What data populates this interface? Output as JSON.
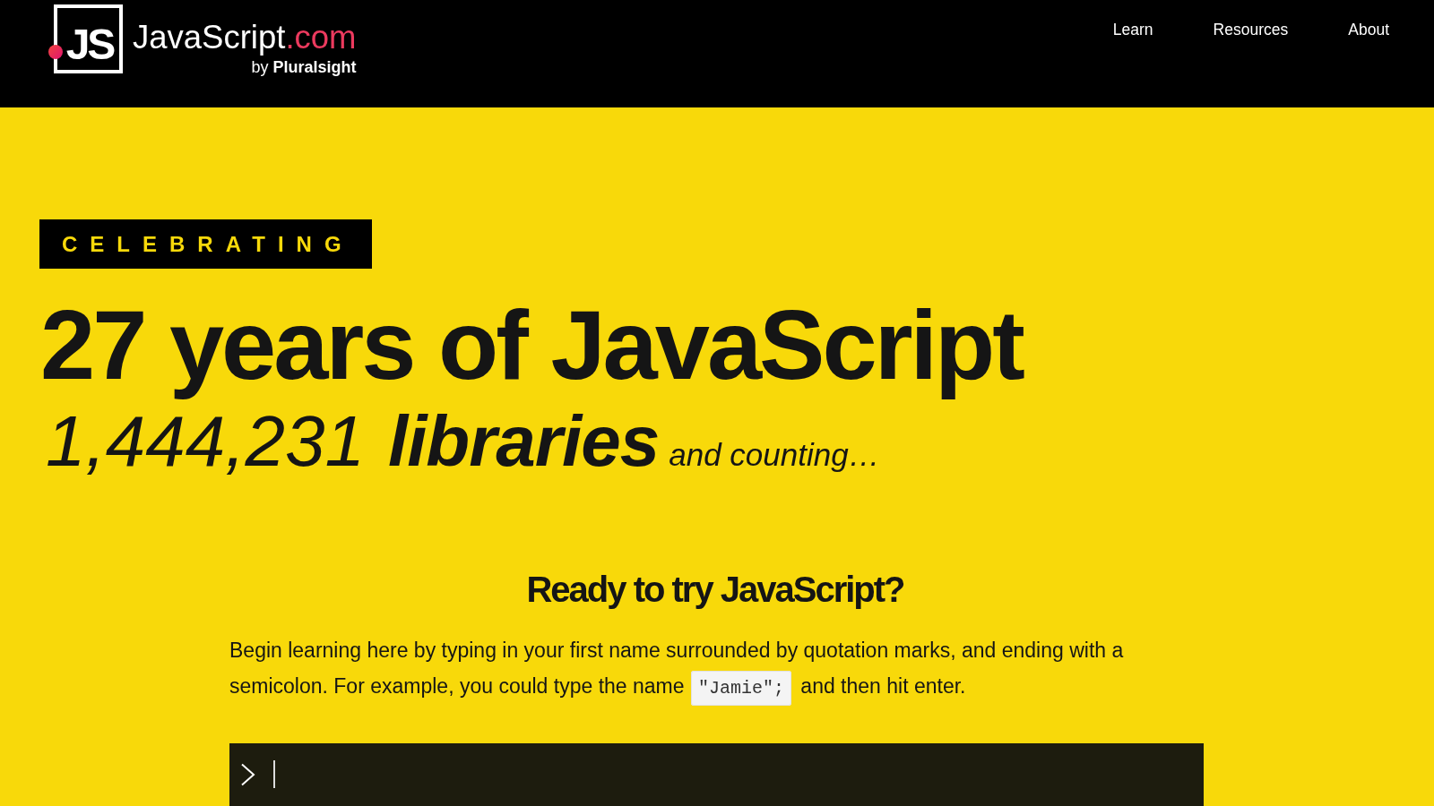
{
  "header": {
    "logo": {
      "mark": "JS",
      "wordmark": "JavaScript",
      "domain": ".com",
      "byline": "by **Pluralsight**"
    },
    "nav": [
      {
        "label": "Learn"
      },
      {
        "label": "Resources"
      },
      {
        "label": "About"
      }
    ]
  },
  "hero": {
    "badge": "CELEBRATING",
    "headline": "27 years of JavaScript",
    "library_count": "1,444,231",
    "count_unit": "libraries",
    "count_suffix": "and counting…"
  },
  "try_section": {
    "title": "Ready to try JavaScript?",
    "instructions_before": "Begin learning here by typing in your first name surrounded by quotation marks, and ending with a semicolon. For example, you could type the name",
    "code_example": "\"Jamie\";",
    "instructions_after": "and then hit enter."
  }
}
